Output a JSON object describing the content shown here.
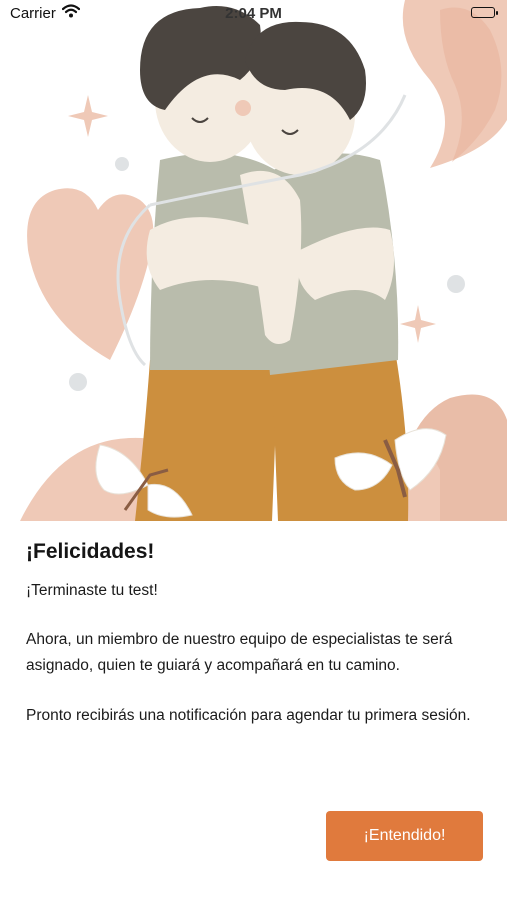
{
  "status_bar": {
    "carrier": "Carrier",
    "time": "2:04 PM"
  },
  "illustration": {
    "icon": "hugging-couple-illustration",
    "colors": {
      "peach": "#efc9b7",
      "hair": "#4b4540",
      "shirt": "#b9bcac",
      "pants": "#cc8f3e",
      "skin": "#f4ece1"
    }
  },
  "message": {
    "title": "¡Felicidades!",
    "subtitle": "¡Terminaste tu test!",
    "paragraph_1": "Ahora, un miembro de nuestro equipo de especialistas te será asignado, quien te guiará y acompañará en tu camino.",
    "paragraph_2": "Pronto recibirás una notificación para agendar tu primera sesión."
  },
  "actions": {
    "confirm_label": "¡Entendido!",
    "confirm_color": "#e07a3d"
  }
}
